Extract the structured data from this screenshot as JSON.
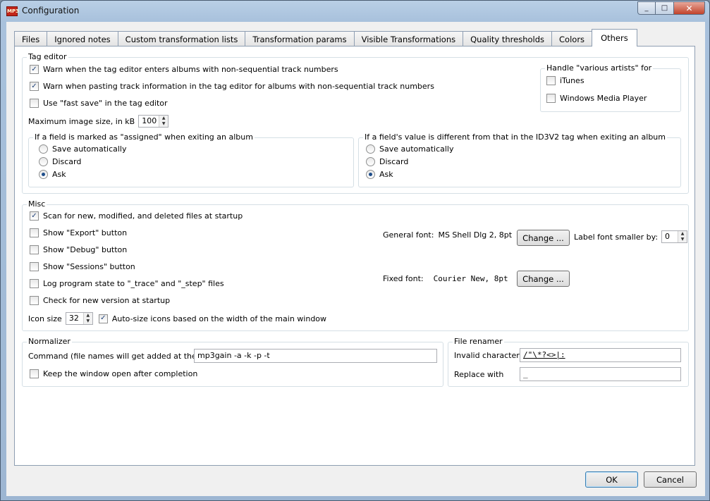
{
  "window": {
    "title": "Configuration",
    "app_icon_text": "MP3"
  },
  "caption": {
    "minimize": "_",
    "maximize": "□",
    "close": "✕"
  },
  "tabs": [
    {
      "label": "Files"
    },
    {
      "label": "Ignored notes"
    },
    {
      "label": "Custom transformation lists"
    },
    {
      "label": "Transformation params"
    },
    {
      "label": "Visible Transformations"
    },
    {
      "label": "Quality thresholds"
    },
    {
      "label": "Colors"
    },
    {
      "label": "Others",
      "active": true
    }
  ],
  "tag_editor": {
    "legend": "Tag editor",
    "warn_non_sequential": {
      "label": "Warn when the tag editor enters albums with non-sequential track numbers",
      "checked": true
    },
    "warn_pasting": {
      "label": "Warn when pasting track information in the tag editor for albums with non-sequential track numbers",
      "checked": true
    },
    "fast_save": {
      "label": "Use \"fast save\" in the tag editor",
      "checked": false
    },
    "max_image_label": "Maximum image size, in kB",
    "max_image_value": "100",
    "various_artists": {
      "legend": "Handle \"various artists\" for",
      "itunes": {
        "label": "iTunes",
        "checked": false
      },
      "wmp": {
        "label": "Windows Media Player",
        "checked": false
      }
    },
    "assigned_group": {
      "legend": "If a field is marked as \"assigned\" when exiting an album",
      "options": [
        "Save automatically",
        "Discard",
        "Ask"
      ],
      "selected": "Ask"
    },
    "id3v2_group": {
      "legend": "If a field's value is different from that in the ID3V2 tag when exiting an album",
      "options": [
        "Save automatically",
        "Discard",
        "Ask"
      ],
      "selected": "Ask"
    }
  },
  "misc": {
    "legend": "Misc",
    "scan_startup": {
      "label": "Scan for new, modified, and deleted files at startup",
      "checked": true
    },
    "show_export": {
      "label": "Show \"Export\" button",
      "checked": false
    },
    "show_debug": {
      "label": "Show \"Debug\" button",
      "checked": false
    },
    "show_sessions": {
      "label": "Show \"Sessions\" button",
      "checked": false
    },
    "log_state": {
      "label": "Log program state to \"_trace\" and \"_step\" files",
      "checked": false
    },
    "check_version": {
      "label": "Check for new version at startup",
      "checked": false
    },
    "icon_size_label": "Icon size",
    "icon_size_value": "32",
    "auto_size": {
      "label": "Auto-size icons based on the width of the main window",
      "checked": true
    },
    "general_font_label": "General font:",
    "general_font_value": "MS Shell Dlg 2, 8pt",
    "change_label": "Change ...",
    "label_font_smaller_label": "Label font smaller by:",
    "label_font_smaller_value": "0",
    "fixed_font_label": "Fixed font:",
    "fixed_font_value": "Courier New, 8pt"
  },
  "normalizer": {
    "legend": "Normalizer",
    "command_label": "Command (file names will get added at the end)",
    "command_value": "mp3gain -a -k -p -t",
    "keep_open": {
      "label": "Keep the window open after completion",
      "checked": false
    }
  },
  "file_renamer": {
    "legend": "File renamer",
    "invalid_label": "Invalid characters",
    "invalid_value": "/\"\\*?<>|:",
    "replace_label": "Replace with",
    "replace_value": "_"
  },
  "buttons": {
    "ok": "OK",
    "cancel": "Cancel"
  },
  "check_glyph": "✓"
}
